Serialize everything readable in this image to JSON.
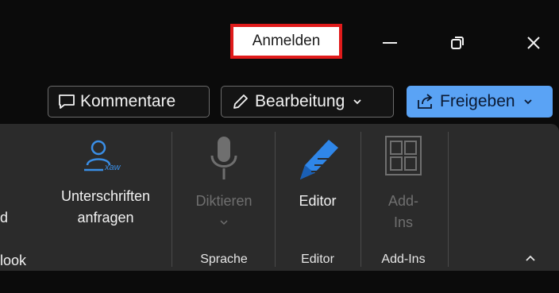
{
  "titlebar": {
    "signin_label": "Anmelden",
    "minimize_icon": "minimize-icon",
    "restore_icon": "restore-icon",
    "close_icon": "close-icon"
  },
  "actions": {
    "comments_label": "Kommentare",
    "editing_label": "Bearbeitung",
    "share_label": "Freigeben",
    "share_color": "#5aa3f5"
  },
  "ribbon": {
    "partial_left_line1": "d",
    "partial_left_line2": "look",
    "request_signatures": "Unterschriften\nanfragen",
    "dictate": "Diktieren",
    "editor": "Editor",
    "addins": "Add-\nIns",
    "groups": {
      "sprache": "Sprache",
      "editor": "Editor",
      "addins": "Add-Ins"
    },
    "collapse_icon": "chevron-up-icon"
  }
}
